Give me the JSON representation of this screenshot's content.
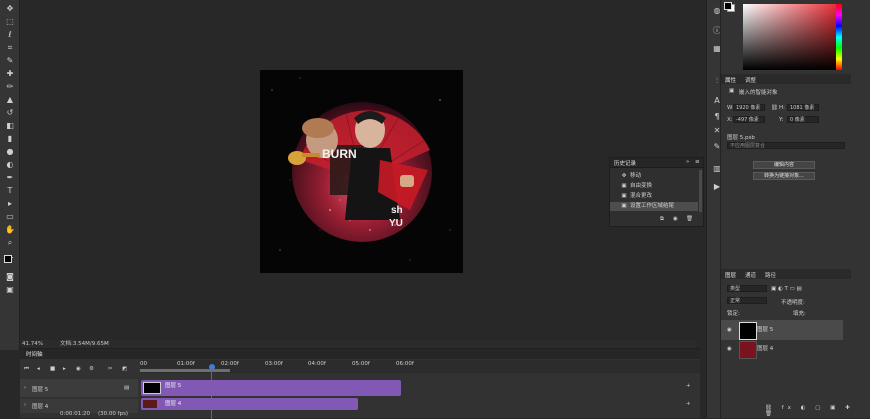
{
  "status": {
    "zoom": "41.74%",
    "doc_label": "文档:3.54M/9.65M"
  },
  "history": {
    "title": "历史记录",
    "items": [
      {
        "label": "移动"
      },
      {
        "label": "自由变换"
      },
      {
        "label": "混合更改"
      },
      {
        "label": "设置工作区域结尾"
      }
    ]
  },
  "properties": {
    "tabs": [
      "属性",
      "调整"
    ],
    "object_label": "嵌入的智能对象",
    "w_label": "W:",
    "w_value": "1920 像素",
    "h_label": "H:",
    "h_value": "1081 像素",
    "x_label": "X:",
    "x_value": "-497 像素",
    "y_label": "Y:",
    "y_value": "0 像素",
    "file_label": "图层 5.psb",
    "layer_comp_placeholder": "不应用图层复合",
    "edit_contents_button": "编辑内容",
    "convert_button": "转换为链接对象..."
  },
  "layers": {
    "tabs": [
      "图层",
      "通道",
      "路径"
    ],
    "filter_label": "类型",
    "blend_mode": "正常",
    "opacity_label": "不透明度:",
    "lock_label": "锁定:",
    "fill_label": "填充:",
    "items": [
      {
        "name": "图层 5",
        "selected": true
      },
      {
        "name": "图层 4",
        "selected": false
      }
    ]
  },
  "timeline": {
    "title": "时间轴",
    "ruler": [
      "00",
      "01:00f",
      "02:00f",
      "03:00f",
      "04:00f",
      "05:00f",
      "06:00f"
    ],
    "tracks": [
      {
        "name": "图层 5",
        "clip_label": "图层 5"
      },
      {
        "name": "图层 4",
        "clip_label": "图层 4"
      }
    ],
    "timecode": "0:00:01:20",
    "fps": "(30.00 fps)"
  },
  "artwork": {
    "headline_word": "BURN",
    "side_text_1": "sh",
    "side_text_2": "YU"
  },
  "colors": {
    "accent": "#ba3140",
    "clip": "#8159b5",
    "playhead": "#d83838"
  }
}
